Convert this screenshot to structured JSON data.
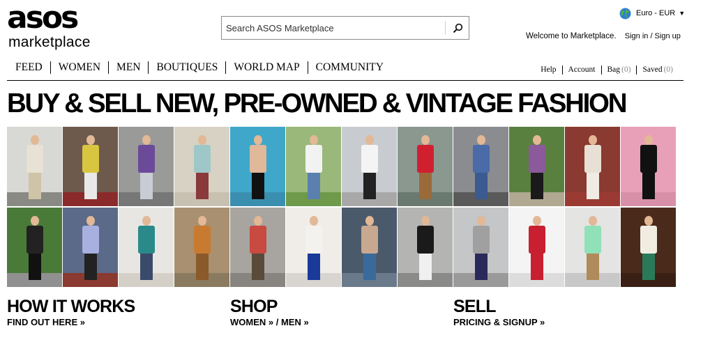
{
  "logo": {
    "main": "asos",
    "sub": "marketplace"
  },
  "search": {
    "placeholder": "Search ASOS Marketplace",
    "icon": "search-icon"
  },
  "currency": {
    "label": "Euro - EUR",
    "caret": "▼",
    "icon": "globe-icon"
  },
  "welcome": {
    "text": "Welcome to Marketplace.",
    "signin": "Sign in / Sign up"
  },
  "nav": {
    "items": [
      "FEED",
      "WOMEN",
      "MEN",
      "BOUTIQUES",
      "WORLD MAP",
      "COMMUNITY"
    ],
    "utility": [
      {
        "label": "Help",
        "count": ""
      },
      {
        "label": "Account",
        "count": ""
      },
      {
        "label": "Bag",
        "count": "(0)"
      },
      {
        "label": "Saved",
        "count": "(0)"
      }
    ]
  },
  "headline": "BUY & SELL NEW, PRE-OWNED & VINTAGE FASHION",
  "grid": {
    "tiles": [
      {
        "bg": "#d8d8d4",
        "top": "#e8e2d4",
        "bottom": "#cfc4a8",
        "ground": "#8a8a84"
      },
      {
        "bg": "#6e5a4c",
        "top": "#d9c640",
        "bottom": "#e8e8e8",
        "ground": "#8b2a2a"
      },
      {
        "bg": "#9a9a98",
        "top": "#6b4a9a",
        "bottom": "#c8ccd4",
        "ground": "#777777"
      },
      {
        "bg": "#d8d2c4",
        "top": "#9ec8c8",
        "bottom": "#8a3a3a",
        "ground": "#c8c0b0"
      },
      {
        "bg": "#3fa7c9",
        "top": "#e0b89a",
        "bottom": "#111111",
        "ground": "#3a8fb0"
      },
      {
        "bg": "#9ab87a",
        "top": "#f2f2f2",
        "bottom": "#5a80b0",
        "ground": "#6e9a4a"
      },
      {
        "bg": "#c8ccd0",
        "top": "#f4f4f4",
        "bottom": "#222222",
        "ground": "#a8a8a8"
      },
      {
        "bg": "#8a9890",
        "top": "#d02030",
        "bottom": "#9a6a3a",
        "ground": "#6a7a70"
      },
      {
        "bg": "#8a8c90",
        "top": "#4a6aa8",
        "bottom": "#3a5a90",
        "ground": "#5a5a5a"
      },
      {
        "bg": "#5a8040",
        "top": "#8a5a9a",
        "bottom": "#1a1a1a",
        "ground": "#b0a890"
      },
      {
        "bg": "#8a3a30",
        "top": "#e8e0d4",
        "bottom": "#f0ece4",
        "ground": "#9a3a32"
      },
      {
        "bg": "#e8a0b8",
        "top": "#111111",
        "bottom": "#111111",
        "ground": "#d890a8"
      },
      {
        "bg": "#4a7a38",
        "top": "#222222",
        "bottom": "#111111",
        "ground": "#909090"
      },
      {
        "bg": "#5a6a88",
        "top": "#a8b0e0",
        "bottom": "#222222",
        "ground": "#8a3a30"
      },
      {
        "bg": "#e8e6e2",
        "top": "#2a8a8a",
        "bottom": "#3a4a6a",
        "ground": "#d4d0c8"
      },
      {
        "bg": "#a89070",
        "top": "#c87a30",
        "bottom": "#8a5a2a",
        "ground": "#8a7a60"
      },
      {
        "bg": "#a8a4a0",
        "top": "#c84a40",
        "bottom": "#5a4a3a",
        "ground": "#888480"
      },
      {
        "bg": "#f0ece8",
        "top": "#f4f2ee",
        "bottom": "#1a3a9a",
        "ground": "#d8d4d0"
      },
      {
        "bg": "#4a5a6a",
        "top": "#c8a890",
        "bottom": "#3a6a9a",
        "ground": "#6a7a8a"
      },
      {
        "bg": "#b4b4b2",
        "top": "#1a1a1a",
        "bottom": "#f0f0f0",
        "ground": "#8a8a88"
      },
      {
        "bg": "#c4c6c8",
        "top": "#a0a0a0",
        "bottom": "#2a2a5a",
        "ground": "#9a9a9a"
      },
      {
        "bg": "#f4f4f4",
        "top": "#c82030",
        "bottom": "#c82030",
        "ground": "#dcdcdc"
      },
      {
        "bg": "#e4e4e2",
        "top": "#90e0b8",
        "bottom": "#b08a5a",
        "ground": "#c8c8c8"
      },
      {
        "bg": "#4a2a1a",
        "top": "#f0ece0",
        "bottom": "#2a7a5a",
        "ground": "#3a2014"
      }
    ]
  },
  "sections": [
    {
      "title": "HOW IT WORKS",
      "link": "FIND OUT HERE »"
    },
    {
      "title": "SHOP",
      "link": "WOMEN » / MEN »"
    },
    {
      "title": "SELL",
      "link": "PRICING & SIGNUP »"
    }
  ]
}
